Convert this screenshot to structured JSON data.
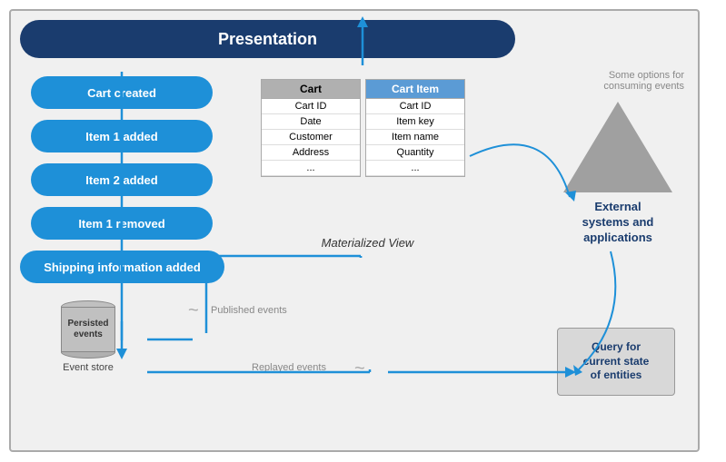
{
  "diagram": {
    "title": "Presentation",
    "some_options_text": "Some options for\nconsuming events",
    "events": [
      {
        "label": "Cart created"
      },
      {
        "label": "Item 1 added"
      },
      {
        "label": "Item 2 added"
      },
      {
        "label": "Item 1 removed"
      },
      {
        "label": "Shipping information added"
      }
    ],
    "cart_table": {
      "header": "Cart",
      "rows": [
        "Cart ID",
        "Date",
        "Customer",
        "Address",
        "..."
      ]
    },
    "cart_item_table": {
      "header": "Cart Item",
      "rows": [
        "Cart ID",
        "Item key",
        "Item name",
        "Quantity",
        "..."
      ]
    },
    "materialized_view_label": "Materialized View",
    "event_store": {
      "body_text": "Persisted\nevents",
      "label": "Event store"
    },
    "published_events_label": "Published events",
    "replayed_events_label": "Replayed events",
    "external_label": "External\nsystems and\napplications",
    "query_box_label": "Query for\ncurrent state\nof entities"
  }
}
